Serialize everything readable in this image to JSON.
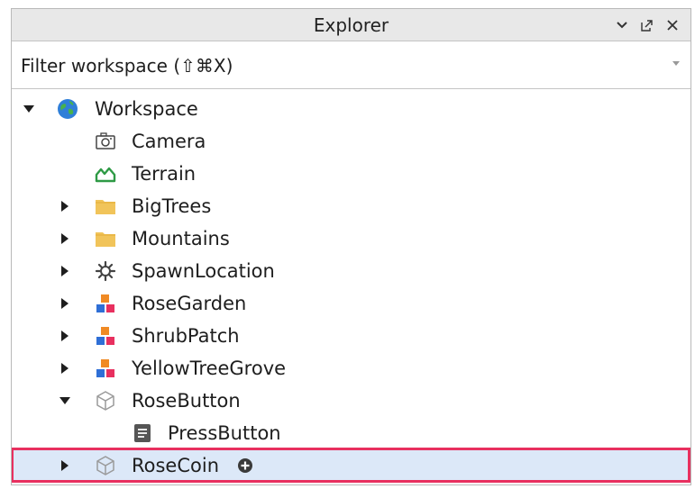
{
  "panel": {
    "title": "Explorer",
    "controls": [
      {
        "name": "chevron-down-icon"
      },
      {
        "name": "popout-icon"
      },
      {
        "name": "close-icon"
      }
    ]
  },
  "filter": {
    "placeholder": "Filter workspace (⇧⌘X)"
  },
  "tree": {
    "items": [
      {
        "label": "Workspace",
        "icon": "globe-icon",
        "depth": 0,
        "expander": "expanded"
      },
      {
        "label": "Camera",
        "icon": "camera-icon",
        "depth": 1,
        "expander": "none"
      },
      {
        "label": "Terrain",
        "icon": "terrain-icon",
        "depth": 1,
        "expander": "none"
      },
      {
        "label": "BigTrees",
        "icon": "folder-icon",
        "depth": 1,
        "expander": "collapsed"
      },
      {
        "label": "Mountains",
        "icon": "folder-icon",
        "depth": 1,
        "expander": "collapsed"
      },
      {
        "label": "SpawnLocation",
        "icon": "spawn-gear-icon",
        "depth": 1,
        "expander": "collapsed"
      },
      {
        "label": "RoseGarden",
        "icon": "model-icon",
        "depth": 1,
        "expander": "collapsed"
      },
      {
        "label": "ShrubPatch",
        "icon": "model-icon",
        "depth": 1,
        "expander": "collapsed"
      },
      {
        "label": "YellowTreeGrove",
        "icon": "model-icon",
        "depth": 1,
        "expander": "collapsed"
      },
      {
        "label": "RoseButton",
        "icon": "part-cube-icon",
        "depth": 1,
        "expander": "expanded"
      },
      {
        "label": "PressButton",
        "icon": "script-icon",
        "depth": 2,
        "expander": "none"
      },
      {
        "label": "RoseCoin",
        "icon": "part-cube-icon",
        "depth": 1,
        "expander": "collapsed",
        "selected": true,
        "action_icon": "add-object-icon"
      }
    ]
  },
  "colors": {
    "selection_background": "#dce8f8",
    "highlight_border": "#e8305f",
    "folder": "#f1c45a",
    "terrain": "#2e9a45"
  }
}
